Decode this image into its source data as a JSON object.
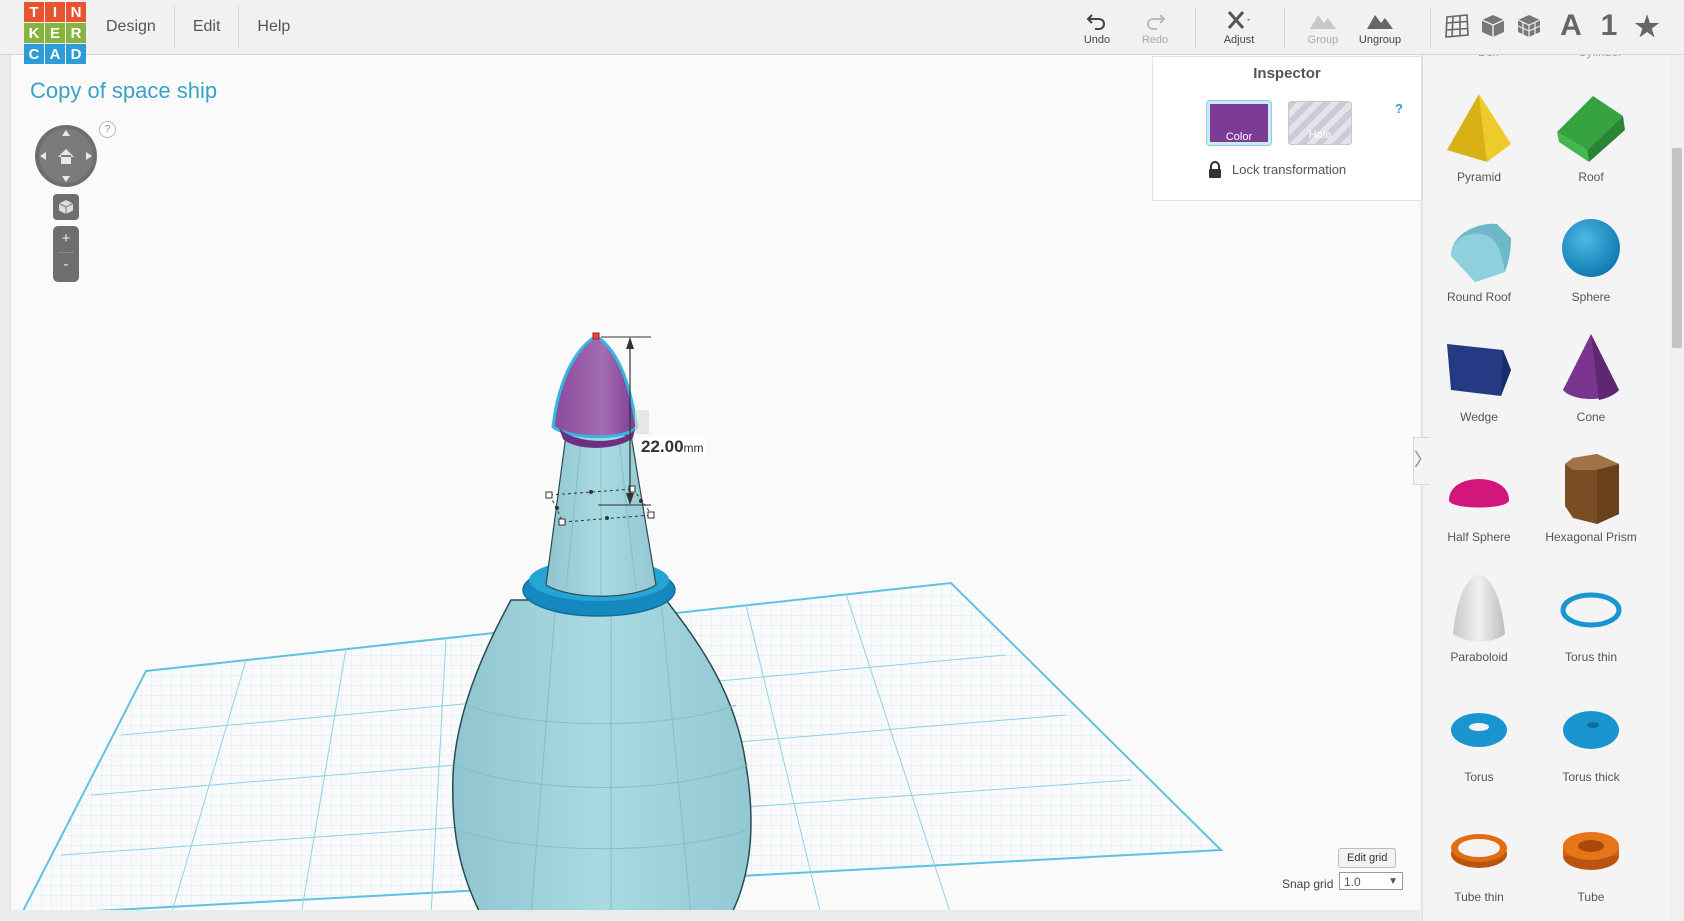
{
  "app": {
    "logo_letters": [
      "T",
      "I",
      "N",
      "K",
      "E",
      "R",
      "C",
      "A",
      "D"
    ],
    "logo_colors": [
      "#e8542f",
      "#e8542f",
      "#e8542f",
      "#86b43f",
      "#86b43f",
      "#86b43f",
      "#2c9bd6",
      "#2c9bd6",
      "#2c9bd6"
    ]
  },
  "menu": [
    "Design",
    "Edit",
    "Help"
  ],
  "toolbar": {
    "undo": "Undo",
    "redo": "Redo",
    "adjust": "Adjust",
    "group": "Group",
    "ungroup": "Ungroup",
    "text_tool": "A",
    "number_tool": "1"
  },
  "project": {
    "title": "Copy of space ship"
  },
  "navigation": {
    "help": "?",
    "zoom_in": "+",
    "zoom_out": "-"
  },
  "inspector": {
    "title": "Inspector",
    "color_label": "Color",
    "hole_label": "Hole",
    "help": "?",
    "lock_label": "Lock transformation",
    "selected_color": "#7c3b94"
  },
  "dimension": {
    "value": "22.00",
    "unit": "mm"
  },
  "grid": {
    "edit_label": "Edit grid",
    "snap_label": "Snap grid",
    "snap_value": "1.0"
  },
  "shapes": [
    {
      "label": "Pyramid",
      "icon": "pyramid-icon",
      "color": "#e5c01f"
    },
    {
      "label": "Roof",
      "icon": "roof-icon",
      "color": "#3aa542"
    },
    {
      "label": "Round Roof",
      "icon": "round-roof-icon",
      "color": "#7fc8d8"
    },
    {
      "label": "Sphere",
      "icon": "sphere-icon",
      "color": "#1a95cf"
    },
    {
      "label": "Wedge",
      "icon": "wedge-icon",
      "color": "#253a85"
    },
    {
      "label": "Cone",
      "icon": "cone-icon",
      "color": "#7a3590"
    },
    {
      "label": "Half Sphere",
      "icon": "half-sphere-icon",
      "color": "#d3167c"
    },
    {
      "label": "Hexagonal Prism",
      "icon": "hexagonal-prism-icon",
      "color": "#8a5a2e"
    },
    {
      "label": "Paraboloid",
      "icon": "paraboloid-icon",
      "color": "#d8d8d8"
    },
    {
      "label": "Torus thin",
      "icon": "torus-thin-icon",
      "color": "#1a95cf"
    },
    {
      "label": "Torus",
      "icon": "torus-icon",
      "color": "#1a95cf"
    },
    {
      "label": "Torus thick",
      "icon": "torus-thick-icon",
      "color": "#1a95cf"
    },
    {
      "label": "Tube thin",
      "icon": "tube-thin-icon",
      "color": "#e06d14"
    },
    {
      "label": "Tube",
      "icon": "tube-icon",
      "color": "#e06d14"
    }
  ]
}
